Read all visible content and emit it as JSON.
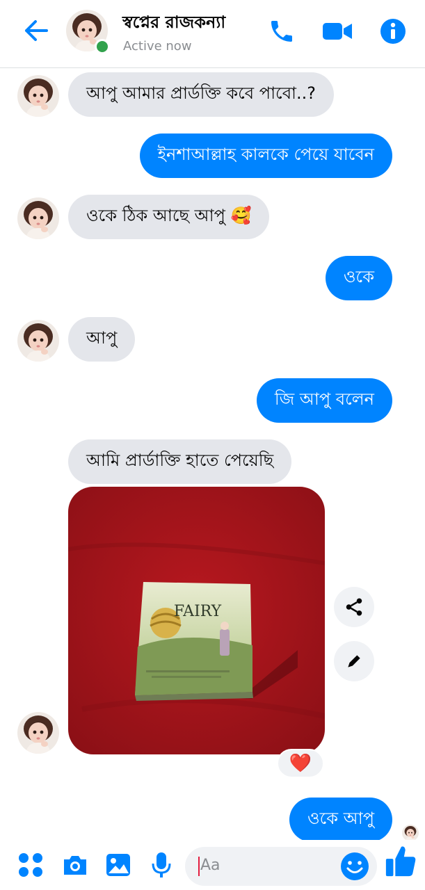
{
  "header": {
    "contact_name": "স্বপ্নের রাজকন্যা",
    "status": "Active now",
    "icons": [
      "back-arrow-icon",
      "phone-icon",
      "video-camera-icon",
      "info-icon"
    ]
  },
  "messages": [
    {
      "side": "received",
      "text": "আপু আমার প্রার্ডক্তি কবে পাবো..?"
    },
    {
      "side": "sent",
      "text": "ইনশাআল্লাহ কালকে পেয়ে যাবেন"
    },
    {
      "side": "received",
      "text": "ওকে ঠিক আছে আপু 🥰"
    },
    {
      "side": "sent",
      "text": "ওকে"
    },
    {
      "side": "received",
      "text": "আপু"
    },
    {
      "side": "sent",
      "text": "জি আপু বলেন"
    },
    {
      "side": "received",
      "text": "আমি প্রার্ডাক্তি হাতে পেয়েছি"
    },
    {
      "side": "received",
      "type": "photo",
      "product_label": "FAIRY",
      "reaction": "❤️"
    },
    {
      "side": "sent",
      "text": "ওকে আপু"
    }
  ],
  "photo_actions": [
    "share-icon",
    "edit-icon"
  ],
  "composer": {
    "placeholder": "Aa",
    "icons": [
      "apps-icon",
      "camera-icon",
      "gallery-icon",
      "microphone-icon",
      "emoji-icon",
      "like-icon"
    ]
  },
  "colors": {
    "accent": "#0084ff",
    "received_bubble": "#e4e6eb",
    "online": "#31a24c",
    "photo_background": "#a6141c"
  }
}
